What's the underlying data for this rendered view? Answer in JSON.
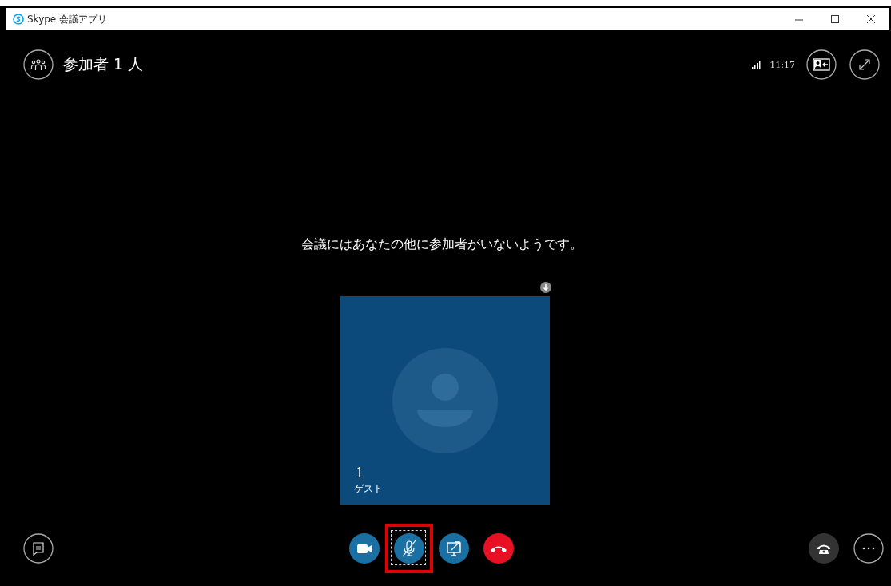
{
  "window": {
    "title": "Skype 会議アプリ"
  },
  "header": {
    "participants_label": "参加者 1 人",
    "time": "11:17"
  },
  "message": "会議にはあなたの他に参加者がいないようです。",
  "tile": {
    "number": "1",
    "label": "ゲスト"
  },
  "call_controls": [
    {
      "kind": "video"
    },
    {
      "kind": "mic",
      "muted": true,
      "focused": true,
      "highlighted": true
    },
    {
      "kind": "share"
    },
    {
      "kind": "hangup"
    }
  ]
}
